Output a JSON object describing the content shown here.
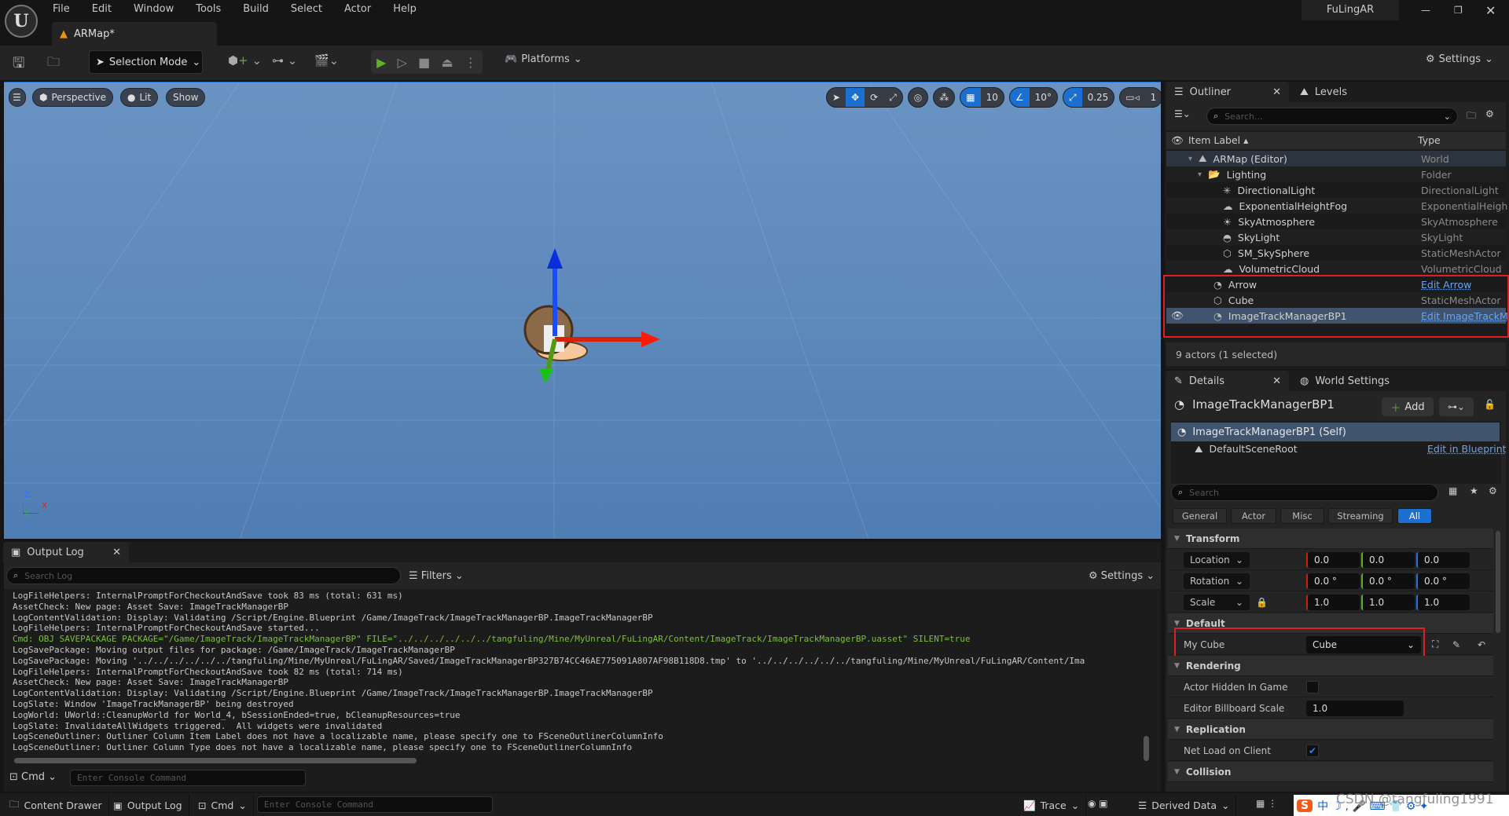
{
  "menu": [
    "File",
    "Edit",
    "Window",
    "Tools",
    "Build",
    "Select",
    "Actor",
    "Help"
  ],
  "project_name": "FuLingAR",
  "doc_tab": "ARMap*",
  "toolbar": {
    "selection_mode": "Selection Mode",
    "platforms": "Platforms",
    "settings": "Settings"
  },
  "viewport": {
    "perspective": "Perspective",
    "lit": "Lit",
    "show": "Show",
    "grid_snap": "10",
    "angle_snap": "10°",
    "scale_snap": "0.25",
    "camera_speed": "1",
    "axis_z": "Z",
    "axis_x": "X",
    "axis_y": "Y"
  },
  "outliner": {
    "tab": "Outliner",
    "levels_tab": "Levels",
    "search_placeholder": "Search...",
    "col_label": "Item Label",
    "col_type": "Type",
    "rows": [
      {
        "label": "ARMap (Editor)",
        "type": "World"
      },
      {
        "label": "Lighting",
        "type": "Folder"
      },
      {
        "label": "DirectionalLight",
        "type": "DirectionalLight"
      },
      {
        "label": "ExponentialHeightFog",
        "type": "ExponentialHeightFog"
      },
      {
        "label": "SkyAtmosphere",
        "type": "SkyAtmosphere"
      },
      {
        "label": "SkyLight",
        "type": "SkyLight"
      },
      {
        "label": "SM_SkySphere",
        "type": "StaticMeshActor"
      },
      {
        "label": "VolumetricCloud",
        "type": "VolumetricCloud"
      },
      {
        "label": "Arrow",
        "type": "Edit Arrow"
      },
      {
        "label": "Cube",
        "type": "StaticMeshActor"
      },
      {
        "label": "ImageTrackManagerBP1",
        "type": "Edit ImageTrackManagerBP"
      }
    ],
    "status": "9 actors (1 selected)"
  },
  "details": {
    "tab": "Details",
    "world_settings_tab": "World Settings",
    "actor_name": "ImageTrackManagerBP1",
    "add": "Add",
    "self": "ImageTrackManagerBP1 (Self)",
    "root": "DefaultSceneRoot",
    "edit_bp": "Edit in Blueprint",
    "search_placeholder": "Search",
    "filters": [
      "General",
      "Actor",
      "Misc",
      "Streaming",
      "All"
    ],
    "transform": "Transform",
    "location": "Location",
    "rotation": "Rotation",
    "scale": "Scale",
    "loc": [
      "0.0",
      "0.0",
      "0.0"
    ],
    "rot": [
      "0.0 °",
      "0.0 °",
      "0.0 °"
    ],
    "scl": [
      "1.0",
      "1.0",
      "1.0"
    ],
    "default": "Default",
    "my_cube": "My Cube",
    "my_cube_value": "Cube",
    "rendering": "Rendering",
    "hidden": "Actor Hidden In Game",
    "hidden_checked": false,
    "billboard": "Editor Billboard Scale",
    "billboard_value": "1.0",
    "replication": "Replication",
    "net_load": "Net Load on Client",
    "net_load_checked": true,
    "collision": "Collision"
  },
  "output": {
    "tab": "Output Log",
    "search_placeholder": "Search Log",
    "filters": "Filters",
    "settings": "Settings",
    "cmd": "Cmd",
    "console_placeholder": "Enter Console Command",
    "lines": [
      "LogFileHelpers: InternalPromptForCheckoutAndSave took 83 ms (total: 631 ms)",
      "AssetCheck: New page: Asset Save: ImageTrackManagerBP",
      "LogContentValidation: Display: Validating /Script/Engine.Blueprint /Game/ImageTrack/ImageTrackManagerBP.ImageTrackManagerBP",
      "LogFileHelpers: InternalPromptForCheckoutAndSave started...",
      "Cmd: OBJ SAVEPACKAGE PACKAGE=\"/Game/ImageTrack/ImageTrackManagerBP\" FILE=\"../../../../../../tangfuling/Mine/MyUnreal/FuLingAR/Content/ImageTrack/ImageTrackManagerBP.uasset\" SILENT=true",
      "LogSavePackage: Moving output files for package: /Game/ImageTrack/ImageTrackManagerBP",
      "LogSavePackage: Moving '../../../../../../tangfuling/Mine/MyUnreal/FuLingAR/Saved/ImageTrackManagerBP327B74CC46AE775091A807AF98B118D8.tmp' to '../../../../../../tangfuling/Mine/MyUnreal/FuLingAR/Content/Ima",
      "LogFileHelpers: InternalPromptForCheckoutAndSave took 82 ms (total: 714 ms)",
      "AssetCheck: New page: Asset Save: ImageTrackManagerBP",
      "LogContentValidation: Display: Validating /Script/Engine.Blueprint /Game/ImageTrack/ImageTrackManagerBP.ImageTrackManagerBP",
      "LogSlate: Window 'ImageTrackManagerBP' being destroyed",
      "LogWorld: UWorld::CleanupWorld for World_4, bSessionEnded=true, bCleanupResources=true",
      "LogSlate: InvalidateAllWidgets triggered.  All widgets were invalidated",
      "LogSceneOutliner: Outliner Column Item Label does not have a localizable name, please specify one to FSceneOutlinerColumnInfo",
      "LogSceneOutliner: Outliner Column Type does not have a localizable name, please specify one to FSceneOutlinerColumnInfo"
    ]
  },
  "statusbar": {
    "content_drawer": "Content Drawer",
    "output_log": "Output Log",
    "cmd": "Cmd",
    "console_placeholder": "Enter Console Command",
    "trace": "Trace",
    "derived_data": "Derived Data"
  },
  "watermark": "CSDN @tangfuling1991",
  "colors": {
    "accent": "#1a6fd0",
    "highlight_box": "#e02020",
    "play": "#5fb02a"
  }
}
